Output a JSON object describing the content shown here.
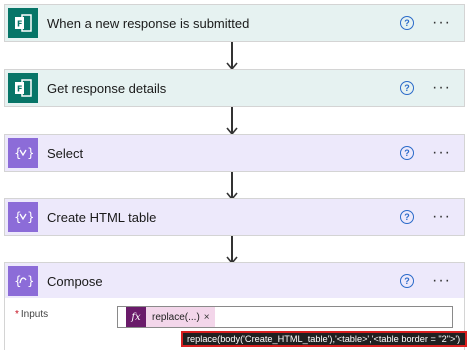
{
  "steps": [
    {
      "title": "When a new response is submitted",
      "icon": "forms-icon",
      "help": "?",
      "more": "···"
    },
    {
      "title": "Get response details",
      "icon": "forms-icon",
      "help": "?",
      "more": "···"
    },
    {
      "title": "Select",
      "icon": "data-operation-icon",
      "help": "?",
      "more": "···"
    },
    {
      "title": "Create HTML table",
      "icon": "data-operation-icon",
      "help": "?",
      "more": "···"
    },
    {
      "title": "Compose",
      "icon": "data-operation-icon",
      "help": "?",
      "more": "···"
    }
  ],
  "compose": {
    "inputs_required": "*",
    "inputs_label": "Inputs",
    "token_fx": "fx",
    "token_label": "replace(...)",
    "token_remove": "×",
    "tooltip": "replace(body('Create_HTML_table'),'<table>','<table border = \"2\">')"
  },
  "colors": {
    "teal_accent": "#077568",
    "purple_accent": "#8c6cd8",
    "teal_bg": "#e6f2f1",
    "purple_bg": "#ede9fb",
    "fx_token": "#6a1b6a",
    "tooltip_border": "#d92020"
  }
}
